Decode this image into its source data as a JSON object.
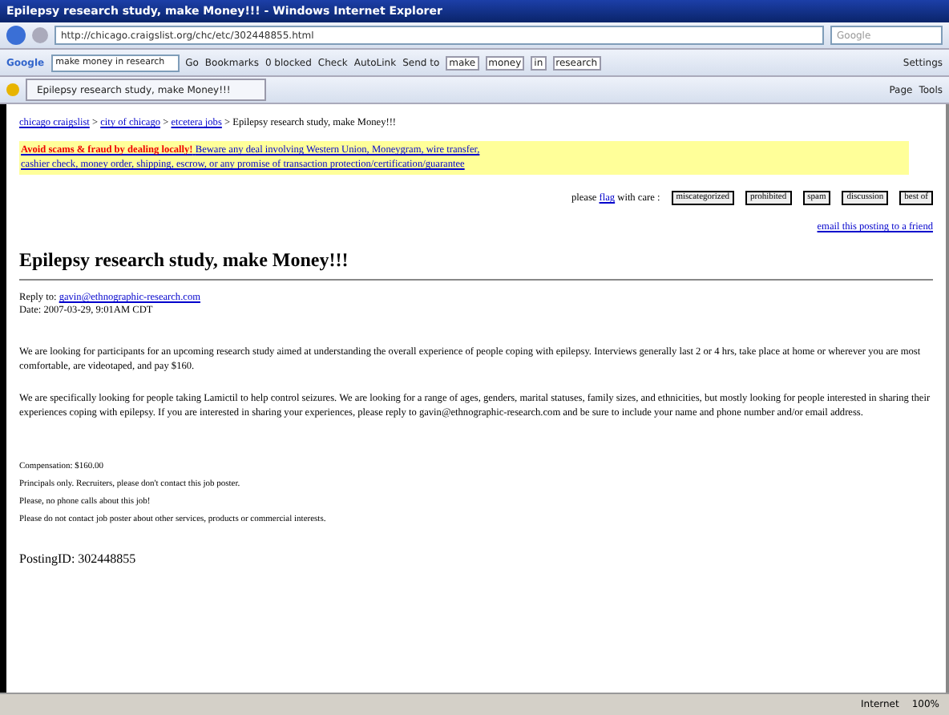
{
  "window": {
    "title": "Epilepsy research study, make Money!!! - Windows Internet Explorer"
  },
  "address_bar": {
    "url": "http://chicago.craigslist.org/chc/etc/302448855.html",
    "search_placeholder": "Google"
  },
  "google_toolbar": {
    "logo": "Google",
    "query": "make money in research",
    "items": [
      "Go",
      "Bookmarks",
      "0 blocked",
      "Check",
      "AutoLink",
      "Send to"
    ],
    "highlight_words": [
      "make",
      "money",
      "in",
      "research"
    ],
    "settings": "Settings"
  },
  "tab": {
    "title": "Epilepsy research study, make Money!!!"
  },
  "command_bar": [
    "Page",
    "Tools"
  ],
  "breadcrumb": {
    "separator": ">",
    "links": [
      "chicago craigslist",
      "city of chicago",
      "etcetera jobs"
    ],
    "current": "Epilepsy research study, make Money!!!"
  },
  "warning": {
    "bold": "Avoid scams & fraud by dealing locally!",
    "text": "Beware any deal involving Western Union, Moneygram, wire transfer,",
    "text_line2": "cashier check, money order, shipping, escrow, or any promise of transaction protection/certification/guarantee"
  },
  "flag": {
    "before": "please",
    "link": "flag",
    "after": "with care :",
    "buttons": [
      "miscategorized",
      "prohibited",
      "spam",
      "discussion",
      "best of"
    ]
  },
  "email_friend": "email this posting to a friend",
  "heading": "Epilepsy research study, make Money!!!",
  "reply_label": "Reply to:",
  "reply_email": "gavin@ethnographic-research.com",
  "date": "Date: 2007-03-29, 9:01AM CDT",
  "paragraphs": [
    "We are looking for participants for an upcoming research study aimed at understanding the overall experience of people coping with epilepsy. Interviews generally last 2 or 4 hrs, take place at home or wherever you are most comfortable, are videotaped, and pay $160.",
    "We are specifically looking for people taking Lamictil to help control seizures. We are looking for a range of ages, genders, marital statuses, family sizes, and ethnicities, but mostly looking for people interested in sharing their experiences coping with epilepsy. If you are interested in sharing your experiences, please reply to gavin@ethnographic-research.com and be sure to include your name and phone number and/or email address."
  ],
  "notes": [
    "Compensation: $160.00",
    "Principals only. Recruiters, please don't contact this job poster.",
    "Please, no phone calls about this job!",
    "Please do not contact job poster about other services, products or commercial interests."
  ],
  "posting_id": "PostingID: 302448855",
  "status_bar": {
    "zone": "Internet",
    "zoom": "100%"
  }
}
